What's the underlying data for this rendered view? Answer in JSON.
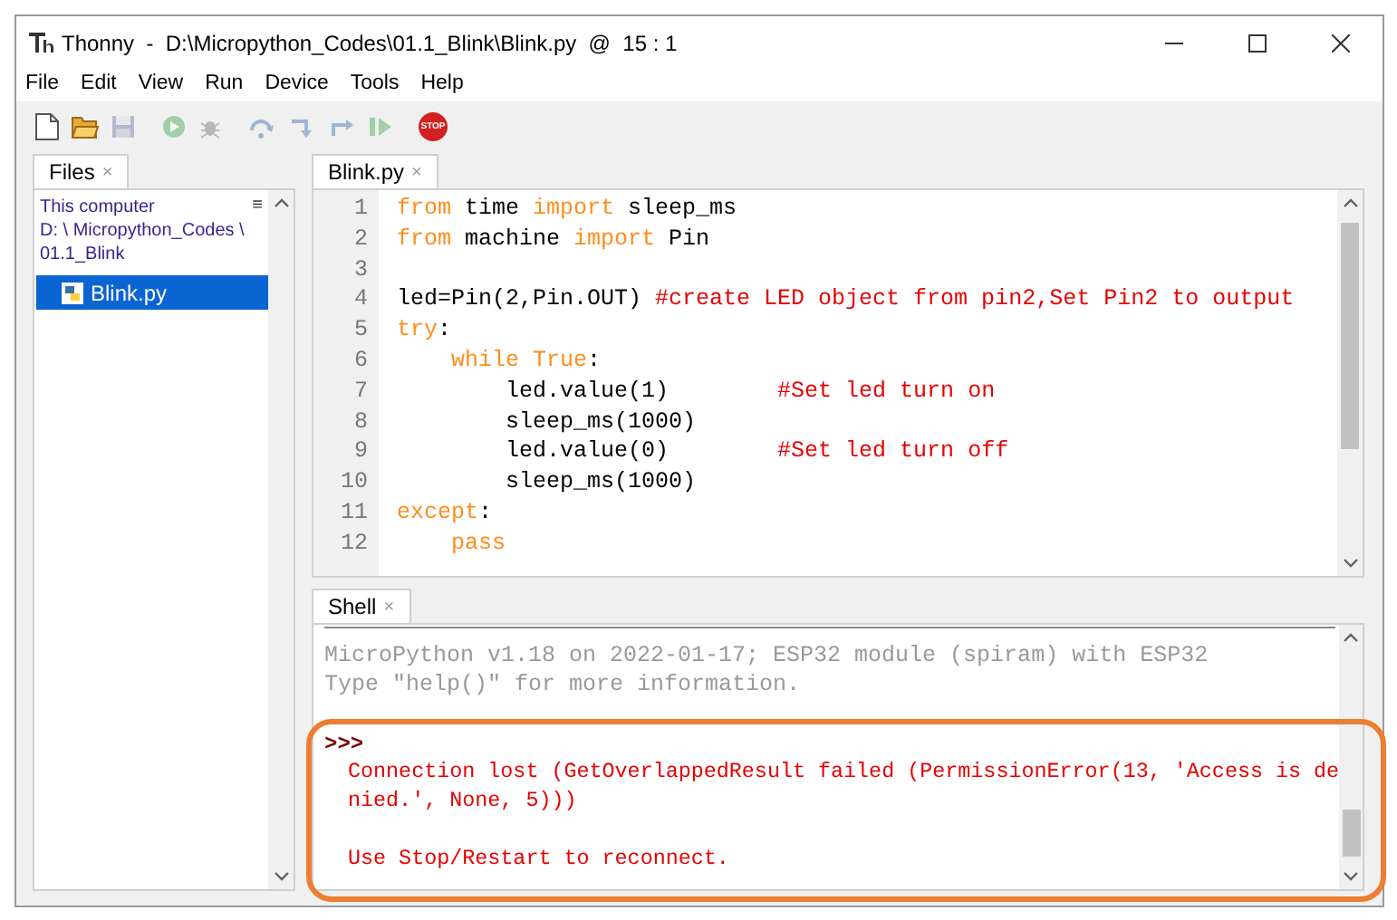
{
  "window": {
    "title": "Thonny  -  D:\\Micropython_Codes\\01.1_Blink\\Blink.py  @  15 : 1"
  },
  "menu": [
    "File",
    "Edit",
    "View",
    "Run",
    "Device",
    "Tools",
    "Help"
  ],
  "toolbar": [
    {
      "kind": "new",
      "disabled": false
    },
    {
      "kind": "open",
      "disabled": false
    },
    {
      "kind": "save",
      "disabled": true
    },
    {
      "kind": "run",
      "disabled": true
    },
    {
      "kind": "debug",
      "disabled": true
    },
    {
      "kind": "step_over",
      "disabled": true
    },
    {
      "kind": "step_into",
      "disabled": true
    },
    {
      "kind": "step_out",
      "disabled": true
    },
    {
      "kind": "resume",
      "disabled": true
    },
    {
      "kind": "stop",
      "disabled": false,
      "label": "STOP"
    }
  ],
  "files": {
    "tab": {
      "label": "Files",
      "close": "×"
    },
    "location": [
      "This computer",
      "D: \\ Micropython_Codes \\",
      "01.1_Blink"
    ],
    "menu_glyph": "≡",
    "items": [
      {
        "name": "Blink.py",
        "selected": true
      }
    ]
  },
  "editor": {
    "tab": {
      "label": "Blink.py",
      "close": "×"
    },
    "lines": [
      {
        "number": "1",
        "segments": [
          {
            "kind": "keyword",
            "text": "from"
          },
          {
            "kind": "plain",
            "text": " time "
          },
          {
            "kind": "keyword",
            "text": "import"
          },
          {
            "kind": "plain",
            "text": " sleep_ms"
          }
        ]
      },
      {
        "number": "2",
        "segments": [
          {
            "kind": "keyword",
            "text": "from"
          },
          {
            "kind": "plain",
            "text": " machine "
          },
          {
            "kind": "keyword",
            "text": "import"
          },
          {
            "kind": "plain",
            "text": " Pin"
          }
        ]
      },
      {
        "number": "3"
      },
      {
        "number": "4",
        "segments": [
          {
            "kind": "plain",
            "text": "led=Pin(2,Pin.OUT) "
          },
          {
            "kind": "comment",
            "text": "#create LED object from pin2,Set Pin2 to output"
          }
        ]
      },
      {
        "number": "5",
        "segments": [
          {
            "kind": "keyword",
            "text": "try"
          },
          {
            "kind": "plain",
            "text": ":"
          }
        ]
      },
      {
        "number": "6",
        "segments": [
          {
            "kind": "keyword",
            "text": "    while True"
          },
          {
            "kind": "plain",
            "text": ":"
          }
        ]
      },
      {
        "number": "7",
        "segments": [
          {
            "kind": "plain",
            "text": "        led.value(1)        "
          },
          {
            "kind": "comment",
            "text": "#Set led turn on"
          }
        ]
      },
      {
        "number": "8",
        "segments": [
          {
            "kind": "plain",
            "text": "        sleep_ms(1000)"
          }
        ]
      },
      {
        "number": "9",
        "segments": [
          {
            "kind": "plain",
            "text": "        led.value(0)        "
          },
          {
            "kind": "comment",
            "text": "#Set led turn off"
          }
        ]
      },
      {
        "number": "10",
        "segments": [
          {
            "kind": "plain",
            "text": "        sleep_ms(1000)"
          }
        ]
      },
      {
        "number": "11",
        "segments": [
          {
            "kind": "keyword",
            "text": "except"
          },
          {
            "kind": "plain",
            "text": ":"
          }
        ]
      },
      {
        "number": "12",
        "segments": [
          {
            "kind": "keyword",
            "text": "    pass"
          }
        ]
      }
    ]
  },
  "shell": {
    "tab": {
      "label": "Shell",
      "close": "×"
    },
    "banner": [
      "MicroPython v1.18 on 2022-01-17; ESP32 module (spiram) with ESP32",
      "Type \"help()\" for more information."
    ],
    "prompt": ">>>",
    "output": [
      [
        "Connection lost (GetOverlappedResult failed (PermissionError(13, 'Access is de",
        "nied.', None, 5)))"
      ],
      [
        "Use Stop/Restart to reconnect."
      ]
    ],
    "highlighted": true
  }
}
